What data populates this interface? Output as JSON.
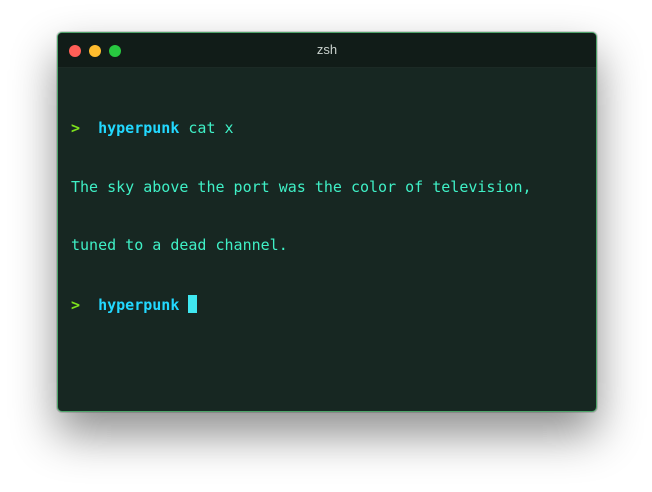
{
  "window": {
    "title": "zsh",
    "controls": {
      "close": "close-button",
      "minimize": "minimize-button",
      "zoom": "zoom-button"
    }
  },
  "terminal": {
    "lines": [
      {
        "prompt_symbol": ">",
        "user": "hyperpunk",
        "command": "cat x"
      },
      {
        "output": "The sky above the port was the color of television,"
      },
      {
        "output": "tuned to a dead channel."
      },
      {
        "prompt_symbol": ">",
        "user": "hyperpunk",
        "command": ""
      }
    ]
  },
  "colors": {
    "background": "#172722",
    "titlebar": "#111c18",
    "prompt": "#7ee21c",
    "user": "#22d8ff",
    "text": "#3ff0c6",
    "cursor": "#3fe7f0"
  }
}
